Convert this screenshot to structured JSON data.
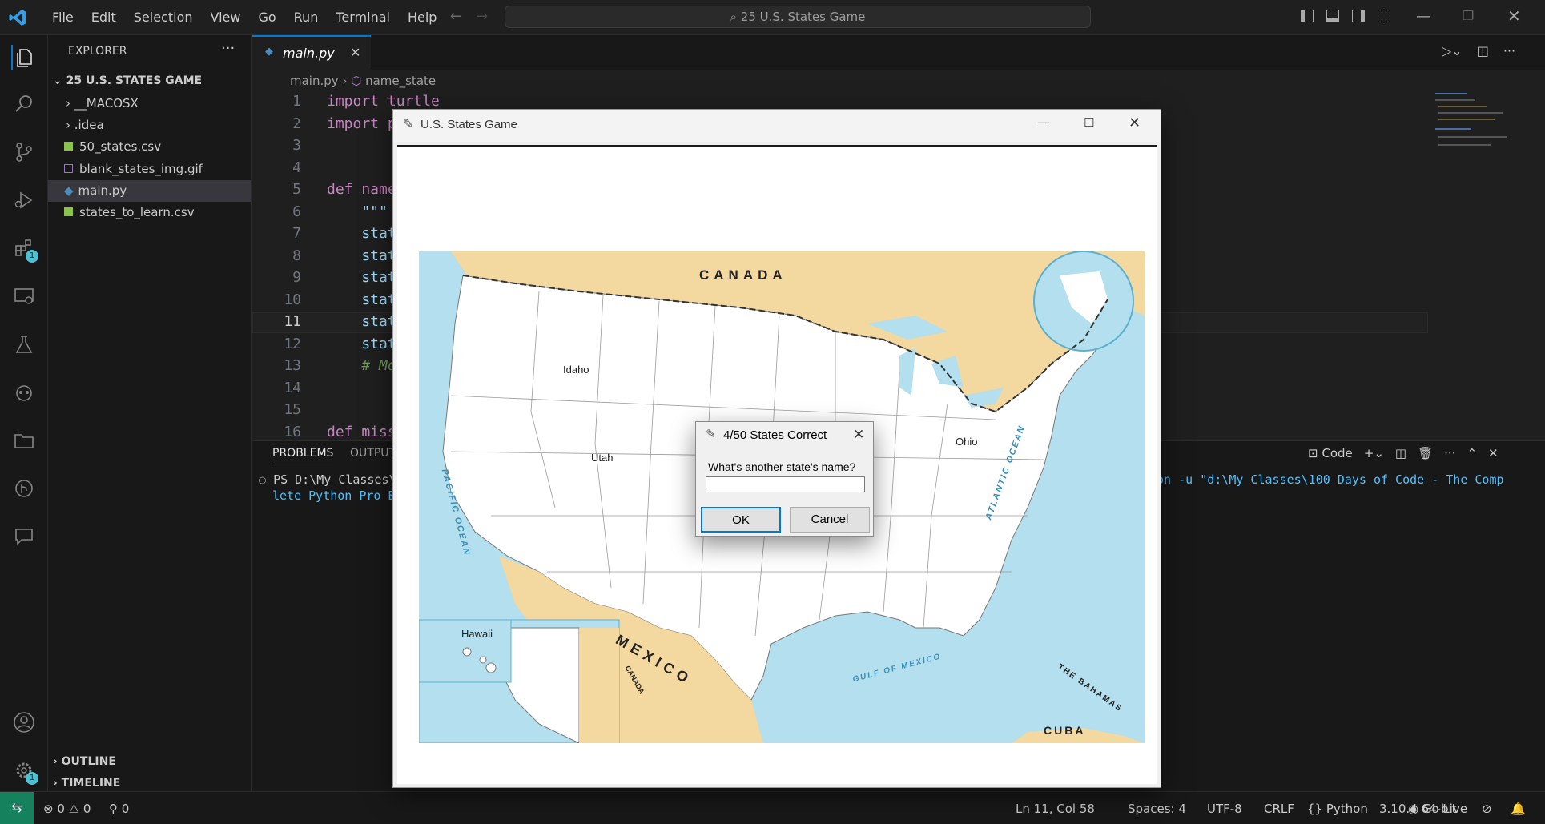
{
  "menu": [
    "File",
    "Edit",
    "Selection",
    "View",
    "Go",
    "Run",
    "Terminal",
    "Help"
  ],
  "search_text": "25 U.S. States Game",
  "explorer": {
    "title": "EXPLORER",
    "folder": "25 U.S. STATES GAME",
    "items": [
      "__MACOSX",
      ".idea",
      "50_states.csv",
      "blank_states_img.gif",
      "main.py",
      "states_to_learn.csv"
    ],
    "outline": "OUTLINE",
    "timeline": "TIMELINE"
  },
  "activity": {
    "extensions_badge": "1",
    "settings_badge": "1"
  },
  "tab": {
    "name": "main.py"
  },
  "breadcrumb": {
    "file": "main.py",
    "symbol": "name_state"
  },
  "code_lines": [
    {
      "n": "1",
      "text": "import turtle"
    },
    {
      "n": "2",
      "text": "import p"
    },
    {
      "n": "3",
      "text": ""
    },
    {
      "n": "4",
      "text": ""
    },
    {
      "n": "5",
      "text": "def name"
    },
    {
      "n": "6",
      "text": "    \"\"\""
    },
    {
      "n": "7",
      "text": "    stat"
    },
    {
      "n": "8",
      "text": "    stat"
    },
    {
      "n": "9",
      "text": "    stat"
    },
    {
      "n": "10",
      "text": "    stat"
    },
    {
      "n": "11",
      "text": "    stat"
    },
    {
      "n": "12",
      "text": "    stat"
    },
    {
      "n": "13",
      "text": "    # Mo"
    },
    {
      "n": "14",
      "text": ""
    },
    {
      "n": "15",
      "text": ""
    },
    {
      "n": "16",
      "text": "def miss"
    }
  ],
  "panel": {
    "tabs": [
      "PROBLEMS",
      "OUTPUT"
    ],
    "terminal_label": "Code",
    "line1_left": "PS D:\\My Classes\\",
    "line1_right": "non -u \"d:\\My Classes\\100 Days of Code - The Comp",
    "line2_left": "lete Python Pro B"
  },
  "turtle_window": {
    "title": "U.S. States Game"
  },
  "map": {
    "labels": {
      "canada": "CANADA",
      "mexico": "MEXICO",
      "cuba": "CUBA",
      "bahamas": "THE BAHAMAS",
      "canada_small": "CANADA"
    },
    "oceans": {
      "pacific": "PACIFIC OCEAN",
      "atlantic": "ATLANTIC OCEAN",
      "gulf": "GULF OF MEXICO"
    },
    "states": {
      "idaho": "Idaho",
      "utah": "Utah",
      "ohio": "Ohio",
      "hawaii": "Hawaii"
    }
  },
  "dialog": {
    "title": "4/50 States Correct",
    "prompt": "What's another state's name?",
    "input_value": "",
    "ok": "OK",
    "cancel": "Cancel"
  },
  "status": {
    "errors": "0",
    "warnings": "0",
    "ports": "0",
    "position": "Ln 11, Col 58",
    "spaces": "Spaces: 4",
    "encoding": "UTF-8",
    "eol": "CRLF",
    "language": "Python",
    "interpreter": "3.10.4 64-bit",
    "golive": "Go Live"
  },
  "colors": {
    "accent": "#0078d4",
    "keyword": "#c586c0",
    "func": "#dcdcaa",
    "land": "#f3d8a0",
    "water": "#b3dfee"
  }
}
